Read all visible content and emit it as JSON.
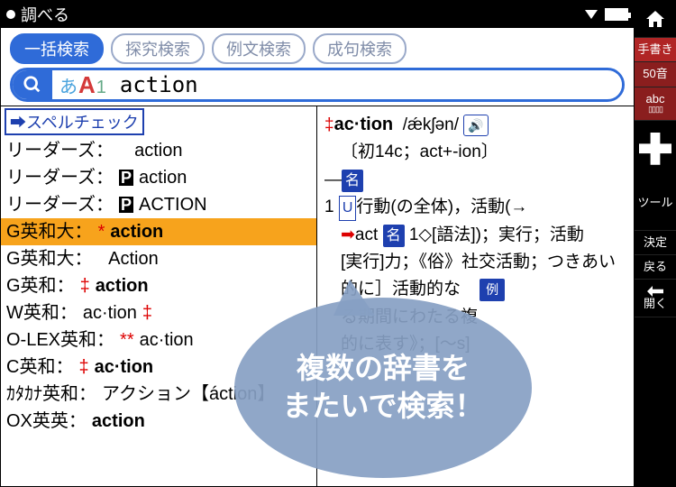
{
  "titlebar": {
    "title": "調べる"
  },
  "tabs": {
    "active": "一括検索",
    "t2": "探究検索",
    "t3": "例文検索",
    "t4": "成句検索"
  },
  "search": {
    "mode_hira": "あ",
    "mode_A": "A",
    "mode_1": "1",
    "value": "action"
  },
  "left": {
    "spellcheck": "➡スペルチェック",
    "rows": [
      {
        "dict": "リーダーズ：",
        "word": "action"
      },
      {
        "dict": "リーダーズ：",
        "pbox": "P",
        "word": "action"
      },
      {
        "dict": "リーダーズ：",
        "pbox": "P",
        "word": "ACTION"
      },
      {
        "dict": "G英和大：",
        "red": "*",
        "word": "action",
        "selected": true
      },
      {
        "dict": "G英和大：",
        "word": "Action"
      },
      {
        "dict": "G英和：",
        "red": "‡",
        "word": "action"
      },
      {
        "dict": "W英和：",
        "word": "ac·tion",
        "suffix_red": "‡"
      },
      {
        "dict": "O-LEX英和：",
        "red": "**",
        "word": "ac·tion"
      },
      {
        "dict": "C英和：",
        "red": "‡",
        "word": "ac·tion"
      },
      {
        "dict": "ｶﾀｶﾅ英和：",
        "word": "アクション【áction】"
      },
      {
        "dict": "OX英英：",
        "word": "action"
      }
    ]
  },
  "right": {
    "head_mark": "‡",
    "head": "ac·tion",
    "ipa": "/ǽkʃən/",
    "etym": "〔初14c；act+-ion〕",
    "pos": "名",
    "sense1_u": "U",
    "sense1": "行動(の全体)，活動(→",
    "line_act": "act",
    "line_act_tag": "名",
    "line_act_rest": "1◇[語法])；実行；活動",
    "line2": "[実行]力；《俗》社交活動；つきあい",
    "line3_pre": "的に］活動的な",
    "line3_ex": "例",
    "line4": "る期間にわたる複",
    "line5": "的に表す》；[～s]"
  },
  "sidebar": {
    "handwrite": "手書き",
    "fifty": "50音",
    "abc": "abc",
    "tool": "ツール",
    "decide": "決定",
    "back": "戻る",
    "open": "開く"
  },
  "callout": {
    "l1": "複数の辞書を",
    "l2": "またいで検索！"
  }
}
